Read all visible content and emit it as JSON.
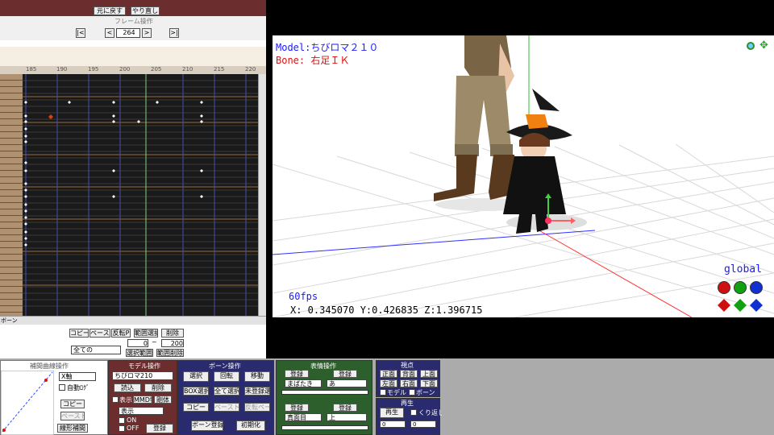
{
  "left_panel": {
    "header_buttons": [
      "元に戻す",
      "やり直し"
    ],
    "frame_label": "フレーム操作",
    "frame_value": "264",
    "frame_nav": [
      "|<",
      "<",
      ">",
      ">|"
    ],
    "ruler_ticks": [
      "185",
      "190",
      "195",
      "200",
      "205",
      "210",
      "215",
      "220"
    ],
    "bottom_buttons": [
      "コピー",
      "ペースト",
      "反転P",
      "範囲選択",
      "削除"
    ],
    "range_from": "0",
    "range_to": "200",
    "range_select": "全ての",
    "range_buttons": [
      "選択範囲",
      "範囲削除"
    ],
    "bottom_left_label": "ボーン"
  },
  "viewport": {
    "model_line": "Model:ちびロマ２１０",
    "bone_line": "Bone: 右足ＩＫ",
    "fps": "60fps",
    "coords": "X: 0.345070 Y:0.426835 Z:1.396715",
    "mode": "global"
  },
  "interp": {
    "title": "補間曲線操作",
    "select": "X軸",
    "auto_label": "自動ﾛｸﾞ",
    "buttons": [
      "コピー",
      "ペースト",
      "線形補間"
    ]
  },
  "model_panel": {
    "title": "モデル操作",
    "model_select": "ちびロマ210",
    "buttons": [
      "読込",
      "削除"
    ],
    "show_label": "表示",
    "mode_buttons": [
      "MMD物理",
      "剛体"
    ],
    "accessory_select": "表示",
    "checks": [
      "ON",
      "OFF"
    ],
    "register": "登録"
  },
  "bone_panel": {
    "title": "ボーン操作",
    "buttons": [
      "選択",
      "回転",
      "移動",
      "BOX選択",
      "全て選択",
      "未登録選択",
      "コピー",
      "ペースト",
      "反転ペースト"
    ],
    "bottom_buttons": [
      "ボーン登録",
      "初期化"
    ]
  },
  "light_panel": {
    "title": "表情操作",
    "top_buttons": [
      "登録",
      "登録"
    ],
    "selects": [
      "まばたき",
      "あ"
    ],
    "mid_buttons": [
      "登録",
      "登録"
    ],
    "mid_selects": [
      "真面目",
      "上"
    ]
  },
  "view_panel": {
    "title": "視点",
    "buttons": [
      "正面",
      "背面",
      "上面",
      "左面",
      "右面",
      "下面"
    ],
    "checks": [
      "モデル",
      "ボーン"
    ]
  },
  "play_panel": {
    "title": "再生",
    "buttons": [
      "再生"
    ],
    "checks": [
      "くり返し"
    ],
    "fields": [
      "0",
      "0"
    ]
  },
  "colors": {
    "panel_red": "#6b2d2d",
    "panel_navy": "#2a2a6e",
    "panel_green": "#2d5f2d",
    "model_text": "#1a1aff",
    "bone_text": "#e01010",
    "fps_text": "#1a1aff",
    "mode_text": "#1a1aff"
  }
}
